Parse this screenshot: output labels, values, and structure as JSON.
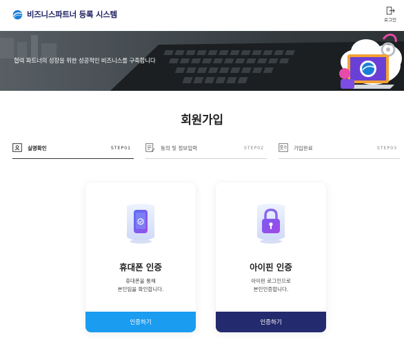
{
  "header": {
    "brand_name": "비즈니스파트너 등록 시스템",
    "login_label": "로그인"
  },
  "banner": {
    "text": "협력 파트너의 성장을 위한 성공적인 비즈니스를 구축합니다"
  },
  "page": {
    "title": "회원가입"
  },
  "steps": [
    {
      "label": "실명확인",
      "code": "STEP01",
      "active": true
    },
    {
      "label": "동의 및 정보입력",
      "code": "STEP02",
      "active": false
    },
    {
      "label": "가입완료",
      "code": "STEP03",
      "active": false
    }
  ],
  "cards": {
    "phone": {
      "title": "휴대폰 인증",
      "desc_line1": "휴대폰을 통해",
      "desc_line2": "본인임을 확인합니다.",
      "button": "인증하기"
    },
    "ipin": {
      "title": "아이핀 인증",
      "desc_line1": "아이핀 로그인으로",
      "desc_line2": "본인인증합니다.",
      "button": "인증하기"
    }
  },
  "colors": {
    "brand_navy": "#1b1e5e",
    "phone_button": "#1a9cf0",
    "ipin_button": "#232a6e"
  }
}
